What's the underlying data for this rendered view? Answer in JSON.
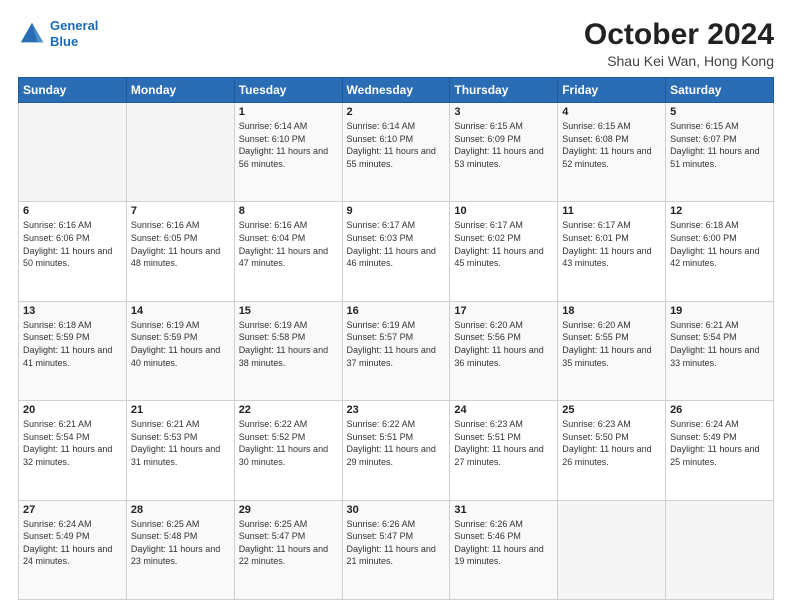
{
  "logo": {
    "line1": "General",
    "line2": "Blue"
  },
  "header": {
    "month": "October 2024",
    "location": "Shau Kei Wan, Hong Kong"
  },
  "weekdays": [
    "Sunday",
    "Monday",
    "Tuesday",
    "Wednesday",
    "Thursday",
    "Friday",
    "Saturday"
  ],
  "weeks": [
    [
      {
        "day": "",
        "sunrise": "",
        "sunset": "",
        "daylight": ""
      },
      {
        "day": "",
        "sunrise": "",
        "sunset": "",
        "daylight": ""
      },
      {
        "day": "1",
        "sunrise": "Sunrise: 6:14 AM",
        "sunset": "Sunset: 6:10 PM",
        "daylight": "Daylight: 11 hours and 56 minutes."
      },
      {
        "day": "2",
        "sunrise": "Sunrise: 6:14 AM",
        "sunset": "Sunset: 6:10 PM",
        "daylight": "Daylight: 11 hours and 55 minutes."
      },
      {
        "day": "3",
        "sunrise": "Sunrise: 6:15 AM",
        "sunset": "Sunset: 6:09 PM",
        "daylight": "Daylight: 11 hours and 53 minutes."
      },
      {
        "day": "4",
        "sunrise": "Sunrise: 6:15 AM",
        "sunset": "Sunset: 6:08 PM",
        "daylight": "Daylight: 11 hours and 52 minutes."
      },
      {
        "day": "5",
        "sunrise": "Sunrise: 6:15 AM",
        "sunset": "Sunset: 6:07 PM",
        "daylight": "Daylight: 11 hours and 51 minutes."
      }
    ],
    [
      {
        "day": "6",
        "sunrise": "Sunrise: 6:16 AM",
        "sunset": "Sunset: 6:06 PM",
        "daylight": "Daylight: 11 hours and 50 minutes."
      },
      {
        "day": "7",
        "sunrise": "Sunrise: 6:16 AM",
        "sunset": "Sunset: 6:05 PM",
        "daylight": "Daylight: 11 hours and 48 minutes."
      },
      {
        "day": "8",
        "sunrise": "Sunrise: 6:16 AM",
        "sunset": "Sunset: 6:04 PM",
        "daylight": "Daylight: 11 hours and 47 minutes."
      },
      {
        "day": "9",
        "sunrise": "Sunrise: 6:17 AM",
        "sunset": "Sunset: 6:03 PM",
        "daylight": "Daylight: 11 hours and 46 minutes."
      },
      {
        "day": "10",
        "sunrise": "Sunrise: 6:17 AM",
        "sunset": "Sunset: 6:02 PM",
        "daylight": "Daylight: 11 hours and 45 minutes."
      },
      {
        "day": "11",
        "sunrise": "Sunrise: 6:17 AM",
        "sunset": "Sunset: 6:01 PM",
        "daylight": "Daylight: 11 hours and 43 minutes."
      },
      {
        "day": "12",
        "sunrise": "Sunrise: 6:18 AM",
        "sunset": "Sunset: 6:00 PM",
        "daylight": "Daylight: 11 hours and 42 minutes."
      }
    ],
    [
      {
        "day": "13",
        "sunrise": "Sunrise: 6:18 AM",
        "sunset": "Sunset: 5:59 PM",
        "daylight": "Daylight: 11 hours and 41 minutes."
      },
      {
        "day": "14",
        "sunrise": "Sunrise: 6:19 AM",
        "sunset": "Sunset: 5:59 PM",
        "daylight": "Daylight: 11 hours and 40 minutes."
      },
      {
        "day": "15",
        "sunrise": "Sunrise: 6:19 AM",
        "sunset": "Sunset: 5:58 PM",
        "daylight": "Daylight: 11 hours and 38 minutes."
      },
      {
        "day": "16",
        "sunrise": "Sunrise: 6:19 AM",
        "sunset": "Sunset: 5:57 PM",
        "daylight": "Daylight: 11 hours and 37 minutes."
      },
      {
        "day": "17",
        "sunrise": "Sunrise: 6:20 AM",
        "sunset": "Sunset: 5:56 PM",
        "daylight": "Daylight: 11 hours and 36 minutes."
      },
      {
        "day": "18",
        "sunrise": "Sunrise: 6:20 AM",
        "sunset": "Sunset: 5:55 PM",
        "daylight": "Daylight: 11 hours and 35 minutes."
      },
      {
        "day": "19",
        "sunrise": "Sunrise: 6:21 AM",
        "sunset": "Sunset: 5:54 PM",
        "daylight": "Daylight: 11 hours and 33 minutes."
      }
    ],
    [
      {
        "day": "20",
        "sunrise": "Sunrise: 6:21 AM",
        "sunset": "Sunset: 5:54 PM",
        "daylight": "Daylight: 11 hours and 32 minutes."
      },
      {
        "day": "21",
        "sunrise": "Sunrise: 6:21 AM",
        "sunset": "Sunset: 5:53 PM",
        "daylight": "Daylight: 11 hours and 31 minutes."
      },
      {
        "day": "22",
        "sunrise": "Sunrise: 6:22 AM",
        "sunset": "Sunset: 5:52 PM",
        "daylight": "Daylight: 11 hours and 30 minutes."
      },
      {
        "day": "23",
        "sunrise": "Sunrise: 6:22 AM",
        "sunset": "Sunset: 5:51 PM",
        "daylight": "Daylight: 11 hours and 29 minutes."
      },
      {
        "day": "24",
        "sunrise": "Sunrise: 6:23 AM",
        "sunset": "Sunset: 5:51 PM",
        "daylight": "Daylight: 11 hours and 27 minutes."
      },
      {
        "day": "25",
        "sunrise": "Sunrise: 6:23 AM",
        "sunset": "Sunset: 5:50 PM",
        "daylight": "Daylight: 11 hours and 26 minutes."
      },
      {
        "day": "26",
        "sunrise": "Sunrise: 6:24 AM",
        "sunset": "Sunset: 5:49 PM",
        "daylight": "Daylight: 11 hours and 25 minutes."
      }
    ],
    [
      {
        "day": "27",
        "sunrise": "Sunrise: 6:24 AM",
        "sunset": "Sunset: 5:49 PM",
        "daylight": "Daylight: 11 hours and 24 minutes."
      },
      {
        "day": "28",
        "sunrise": "Sunrise: 6:25 AM",
        "sunset": "Sunset: 5:48 PM",
        "daylight": "Daylight: 11 hours and 23 minutes."
      },
      {
        "day": "29",
        "sunrise": "Sunrise: 6:25 AM",
        "sunset": "Sunset: 5:47 PM",
        "daylight": "Daylight: 11 hours and 22 minutes."
      },
      {
        "day": "30",
        "sunrise": "Sunrise: 6:26 AM",
        "sunset": "Sunset: 5:47 PM",
        "daylight": "Daylight: 11 hours and 21 minutes."
      },
      {
        "day": "31",
        "sunrise": "Sunrise: 6:26 AM",
        "sunset": "Sunset: 5:46 PM",
        "daylight": "Daylight: 11 hours and 19 minutes."
      },
      {
        "day": "",
        "sunrise": "",
        "sunset": "",
        "daylight": ""
      },
      {
        "day": "",
        "sunrise": "",
        "sunset": "",
        "daylight": ""
      }
    ]
  ]
}
